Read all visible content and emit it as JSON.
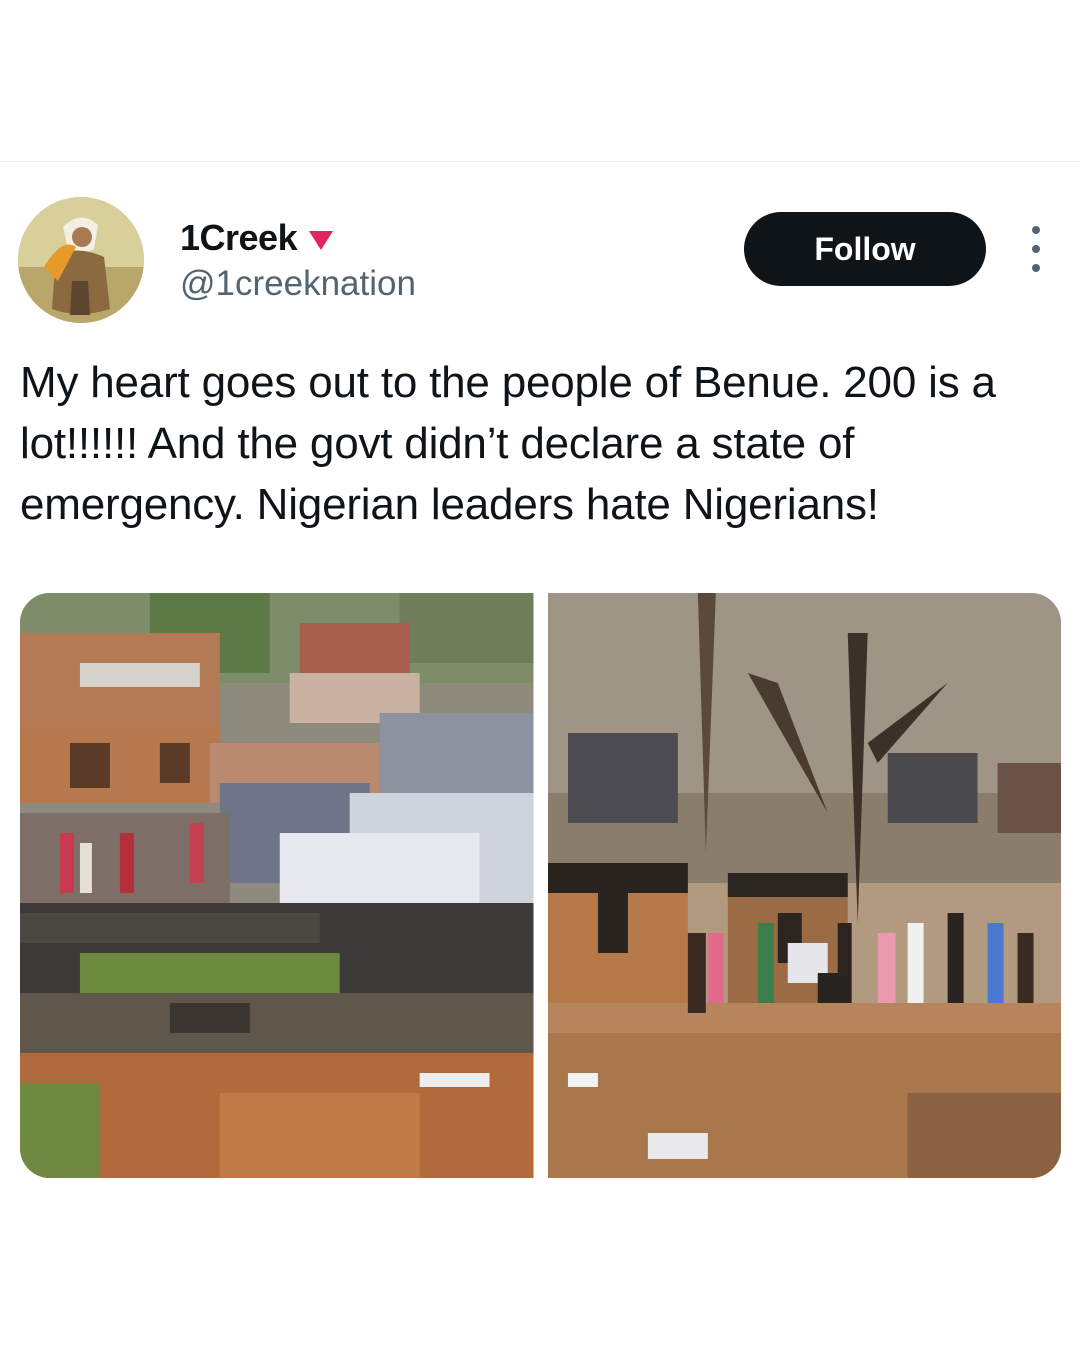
{
  "tweet": {
    "author": {
      "display_name": "1Creek",
      "handle": "@1creeknation",
      "badge_icon": "red-triangle-down-icon",
      "badge_color": "#e0245e"
    },
    "follow_label": "Follow",
    "more_icon": "more-vertical-icon",
    "text": "My heart goes out to the people of Benue. 200 is a lot!!!!!! And the govt didn’t declare a state of emergency. Nigerian leaders hate Nigerians!",
    "media": [
      {
        "kind": "photo",
        "description_icon": "pixelated-burning-village-photo"
      },
      {
        "kind": "photo",
        "description_icon": "burned-village-crowd-photo"
      }
    ]
  },
  "colors": {
    "text_primary": "#0f1419",
    "text_secondary": "#536471",
    "follow_bg": "#0f1419",
    "follow_text": "#ffffff"
  }
}
